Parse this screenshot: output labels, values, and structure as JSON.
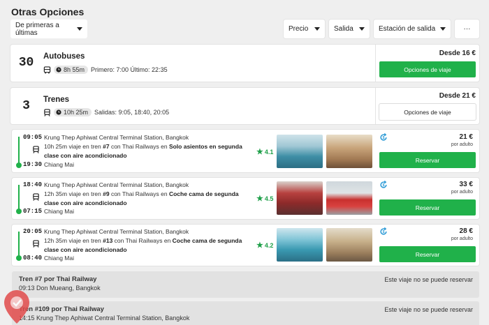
{
  "header": {
    "title": "Otras Opciones"
  },
  "sort": {
    "label": "De primeras a últimas"
  },
  "filters": [
    {
      "label": "Precio"
    },
    {
      "label": "Salida"
    },
    {
      "label": "Estación de salida"
    }
  ],
  "more_button": {
    "label": "···"
  },
  "summary_bus": {
    "count": "30",
    "title": "Autobuses",
    "duration": "8h 55m",
    "schedule": "Primero: 7:00 Último: 22:35",
    "price": "Desde 16 €",
    "button": "Opciones de viaje"
  },
  "summary_train": {
    "count": "3",
    "title": "Trenes",
    "duration": "10h 25m",
    "schedule": "Salidas: 9:05, 18:40, 20:05",
    "price": "Desde 21 €",
    "button": "Opciones de viaje"
  },
  "trips": [
    {
      "dep_time": "09:05",
      "dep_station": "Krung Thep Aphiwat Central Terminal Station, Bangkok",
      "desc_pre": "10h 25m viaje en tren ",
      "train_no": "#7",
      "desc_mid": " con Thai Railways en ",
      "class": "Solo asientos en segunda clase con aire acondicionado",
      "arr_time": "19:30",
      "arr_station": "Chiang Mai",
      "rating": "4.1",
      "price": "21 €",
      "per": "por adulto",
      "button": "Reservar"
    },
    {
      "dep_time": "18:40",
      "dep_station": "Krung Thep Aphiwat Central Terminal Station, Bangkok",
      "desc_pre": "12h 35m viaje en tren ",
      "train_no": "#9",
      "desc_mid": " con Thai Railways en ",
      "class": "Coche cama de segunda clase con aire acondicionado",
      "arr_time": "07:15",
      "arr_station": "Chiang Mai",
      "rating": "4.5",
      "price": "33 €",
      "per": "por adulto",
      "button": "Reservar"
    },
    {
      "dep_time": "20:05",
      "dep_station": "Krung Thep Aphiwat Central Terminal Station, Bangkok",
      "desc_pre": "12h 35m viaje en tren ",
      "train_no": "#13",
      "desc_mid": " con Thai Railways en ",
      "class": "Coche cama de segunda clase con aire acondicionado",
      "arr_time": "08:40",
      "arr_station": "Chiang Mai",
      "rating": "4.2",
      "price": "28 €",
      "per": "por adulto",
      "button": "Reservar"
    }
  ],
  "unavailable": [
    {
      "title": "Tren #7 por Thai Railway",
      "sub": "09:13 Don Mueang, Bangkok",
      "note": "Este viaje no se puede reservar"
    },
    {
      "title": "Tren #109 por Thai Railway",
      "sub": "14:15 Krung Thep Aphiwat Central Terminal Station, Bangkok",
      "note": "Este viaje no se puede reservar"
    }
  ],
  "colors": {
    "accent": "#20b14a",
    "background": "#efefef"
  }
}
